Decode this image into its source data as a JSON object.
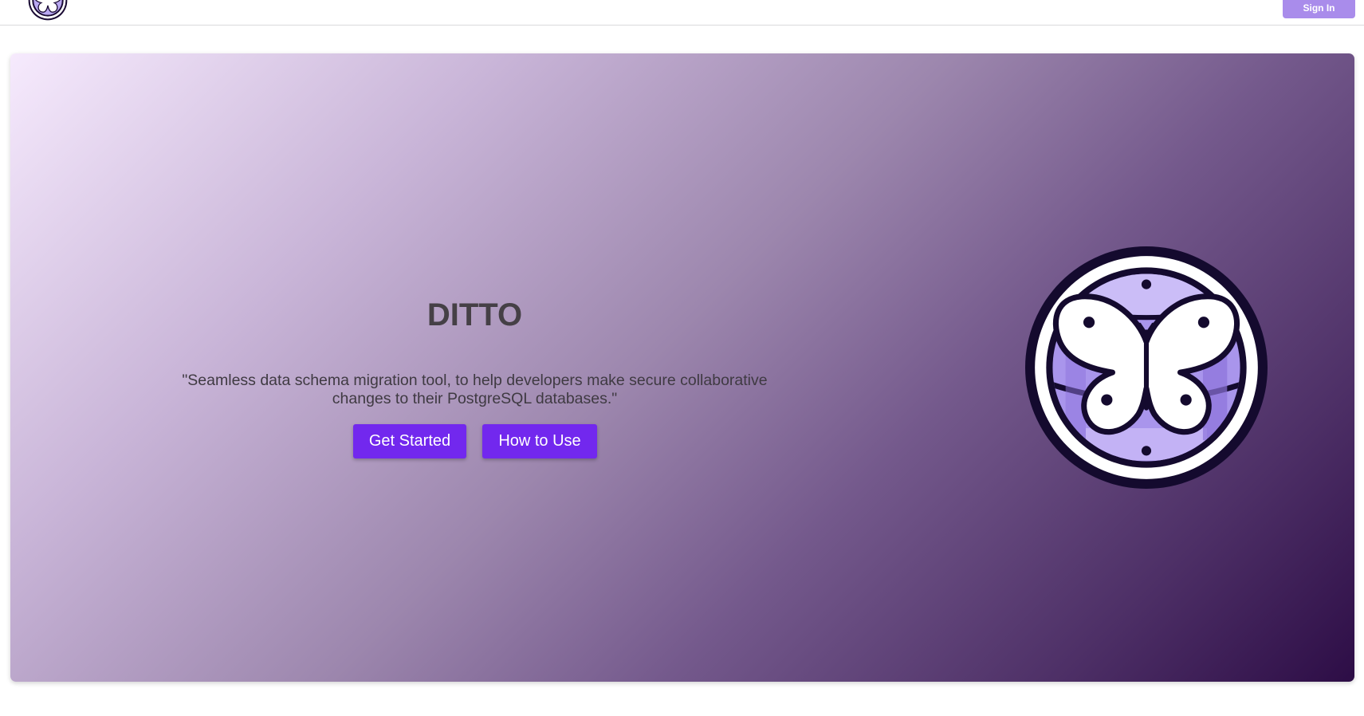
{
  "header": {
    "logo_icon": "ditto-butterfly-logo-icon",
    "sign_in_label": "Sign In"
  },
  "hero": {
    "title": "DITTO",
    "tagline": "\"Seamless data schema migration tool, to help developers make secure collaborative changes to their PostgreSQL databases.\"",
    "get_started_label": "Get Started",
    "how_to_use_label": "How to Use",
    "logo_icon": "butterfly-database-logo-icon"
  },
  "colors": {
    "accent": "#7228ee",
    "sign_in_bg": "#a98ceb",
    "gradient_start": "#f6eafd",
    "gradient_end": "#2d0d46",
    "title_text": "#454046"
  }
}
